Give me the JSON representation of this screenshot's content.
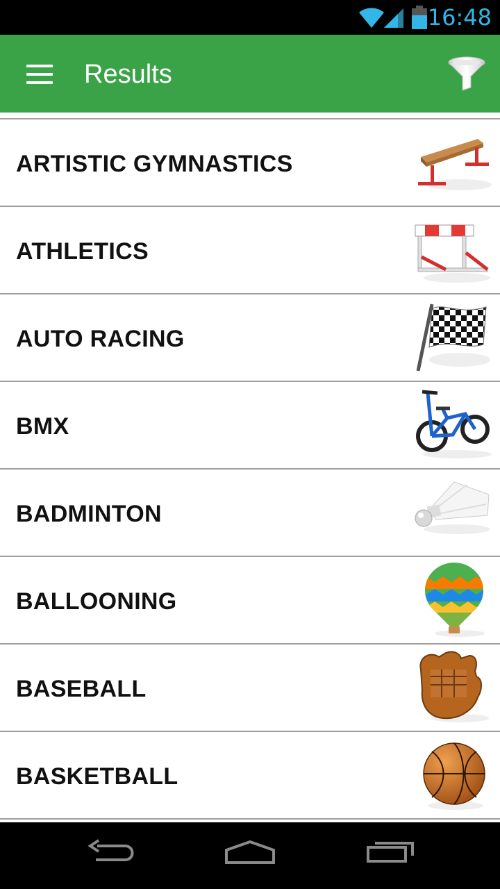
{
  "status_bar": {
    "time": "16:48",
    "icons": [
      "wifi-icon",
      "cell-signal-icon",
      "battery-icon"
    ],
    "accent_color": "#33b5e5"
  },
  "app_bar": {
    "title": "Results",
    "menu_icon": "hamburger-menu-icon",
    "filter_icon": "funnel-filter-icon",
    "color": "#3aa348"
  },
  "sports": [
    {
      "label": "ARTISTIC GYMNASTICS",
      "icon": "balance-beam-icon"
    },
    {
      "label": "ATHLETICS",
      "icon": "hurdle-icon"
    },
    {
      "label": "AUTO RACING",
      "icon": "checkered-flag-icon"
    },
    {
      "label": "BMX",
      "icon": "bmx-bike-icon"
    },
    {
      "label": "BADMINTON",
      "icon": "shuttlecock-icon"
    },
    {
      "label": "BALLOONING",
      "icon": "hot-air-balloon-icon"
    },
    {
      "label": "BASEBALL",
      "icon": "baseball-glove-icon"
    },
    {
      "label": "BASKETBALL",
      "icon": "basketball-icon"
    }
  ],
  "nav_bar": {
    "buttons": [
      "back-icon",
      "home-icon",
      "recent-apps-icon"
    ]
  }
}
